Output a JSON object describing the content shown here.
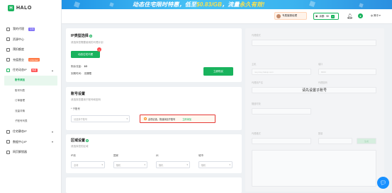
{
  "brand": {
    "name": "HALO",
    "logo_letter": "H",
    "accent": "#19b35d"
  },
  "banner": {
    "text_a": "动态住宅限时特惠，低至",
    "price": "$0.83/GB",
    "text_b": "，流量",
    "highlight": "永久有效!"
  },
  "header": {
    "service": "专属客服经理",
    "balance_label": "余额:",
    "balance_value": "$0",
    "lang": "简中"
  },
  "sidebar": {
    "items": [
      {
        "label": "我的代理",
        "badge": "订阅"
      },
      {
        "label": "资源中心"
      },
      {
        "label": "预扣额度"
      },
      {
        "label": "充值营业",
        "badge": "Unlimited"
      },
      {
        "label": "住宅动态IP",
        "badge": "热卖"
      }
    ],
    "sub_items": [
      "账号添加",
      "账号列表",
      "订单管理",
      "流量详情",
      "子账号列表"
    ],
    "bottom_items": [
      "住宅静态IP",
      "数据中心IP",
      "网页解锁器"
    ]
  },
  "ip_panel": {
    "title": "IP类型选择",
    "subtitle": "请选择您需要使用的代理计划",
    "plan_button": "动态住宅代理",
    "remaining_label": "剩余流量：",
    "remaining_value": "1G",
    "expire_label": "到期时间：",
    "expire_value": "无期限",
    "buy_button": "立即购买"
  },
  "account_panel": {
    "title": "账号设置",
    "subtitle": "请选择您要用于账号和密码",
    "field_label": "* 子账号",
    "field_placeholder": "请选择子账号",
    "alert_text": "此项必选，快速添加子账号",
    "alert_link": "立即添加"
  },
  "region_panel": {
    "title": "区域设置",
    "subtitle": "请选择您的区域",
    "fields": [
      {
        "label": "IP池",
        "placeholder": "全球"
      },
      {
        "label": "国家",
        "placeholder": "随机"
      },
      {
        "label": "州",
        "placeholder": "随机"
      },
      {
        "label": "城市",
        "placeholder": "随机"
      }
    ]
  },
  "right_panel": {
    "overlay_message": "请先设置子账号",
    "fields": [
      {
        "label": "代理模式"
      },
      {
        "label": "主机",
        "value": "na.proxy.haloip.com"
      },
      {
        "label": "端口",
        "value": "8000"
      },
      {
        "label": "代理用户名"
      },
      {
        "label": "代理密码"
      },
      {
        "label": "隧道时效"
      },
      {
        "label": "代理格式"
      },
      {
        "label": "数量"
      }
    ],
    "copy_button": "生成"
  }
}
